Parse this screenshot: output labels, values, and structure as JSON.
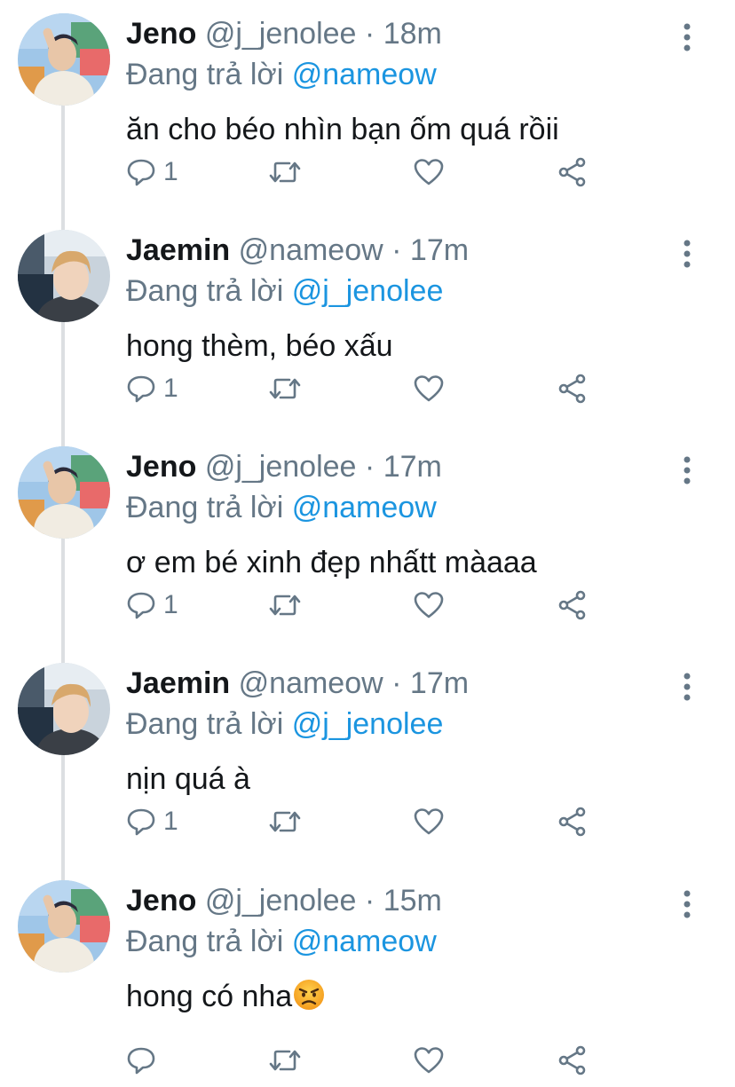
{
  "tweets": [
    {
      "name": "Jeno",
      "handle": "@j_jenolee",
      "dot": "·",
      "time": "18m",
      "replying_prefix": "Đang trả lời",
      "replying_to": "@nameow",
      "text": "ăn cho béo nhìn bạn ốm quá rồii",
      "reply_count": "1",
      "avatar": "jeno"
    },
    {
      "name": "Jaemin",
      "handle": "@nameow",
      "dot": "·",
      "time": "17m",
      "replying_prefix": "Đang trả lời",
      "replying_to": "@j_jenolee",
      "text": "hong thèm, béo xấu",
      "reply_count": "1",
      "avatar": "jaemin"
    },
    {
      "name": "Jeno",
      "handle": "@j_jenolee",
      "dot": "·",
      "time": "17m",
      "replying_prefix": "Đang trả lời",
      "replying_to": "@nameow",
      "text": "ơ em bé xinh đẹp nhấtt màaaa",
      "reply_count": "1",
      "avatar": "jeno"
    },
    {
      "name": "Jaemin",
      "handle": "@nameow",
      "dot": "·",
      "time": "17m",
      "replying_prefix": "Đang trả lời",
      "replying_to": "@j_jenolee",
      "text": "nịn quá à",
      "reply_count": "1",
      "avatar": "jaemin"
    },
    {
      "name": "Jeno",
      "handle": "@j_jenolee",
      "dot": "·",
      "time": "15m",
      "replying_prefix": "Đang trả lời",
      "replying_to": "@nameow",
      "text": "hong có nha",
      "text_emoji": "angry-face-emoji",
      "reply_count": "",
      "avatar": "jeno"
    }
  ],
  "colors": {
    "name": "#14171a",
    "meta": "#657786",
    "mention": "#1b95e0",
    "thread_line": "#dcdfe2",
    "icon": "#657786"
  }
}
